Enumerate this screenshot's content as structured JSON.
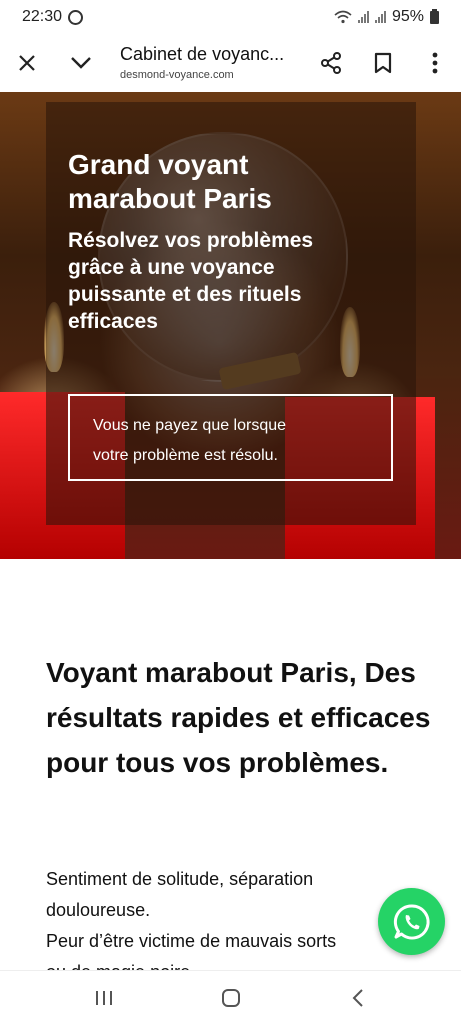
{
  "status": {
    "time": "22:30",
    "battery": "95%"
  },
  "browser": {
    "title": "Cabinet de voyanc...",
    "domain": "desmond-voyance.com"
  },
  "hero": {
    "title": "Grand voyant marabout Paris",
    "subtitle": "Résolvez vos problèmes grâce à une voyance puissante et des rituels efficaces",
    "notice_line1": "Vous ne payez que lorsque",
    "notice_line2": "votre problème est résolu."
  },
  "content": {
    "heading": "Voyant marabout Paris, Des résultats rapides et efficaces pour tous vos problèmes.",
    "line1": "Sentiment de solitude, séparation",
    "line2": "douloureuse.",
    "line3": "Peur d’être victime de mauvais sorts",
    "line4": "ou de magie noire"
  },
  "colors": {
    "whatsapp": "#25d366",
    "candle_red": "#e01010"
  },
  "icons": {
    "close": "close-icon",
    "collapse": "chevron-down-icon",
    "share": "share-icon",
    "bookmark": "bookmark-icon",
    "menu": "more-vert-icon",
    "whatsapp": "whatsapp-icon",
    "recents": "recents-icon",
    "home": "home-icon",
    "back": "back-icon"
  }
}
